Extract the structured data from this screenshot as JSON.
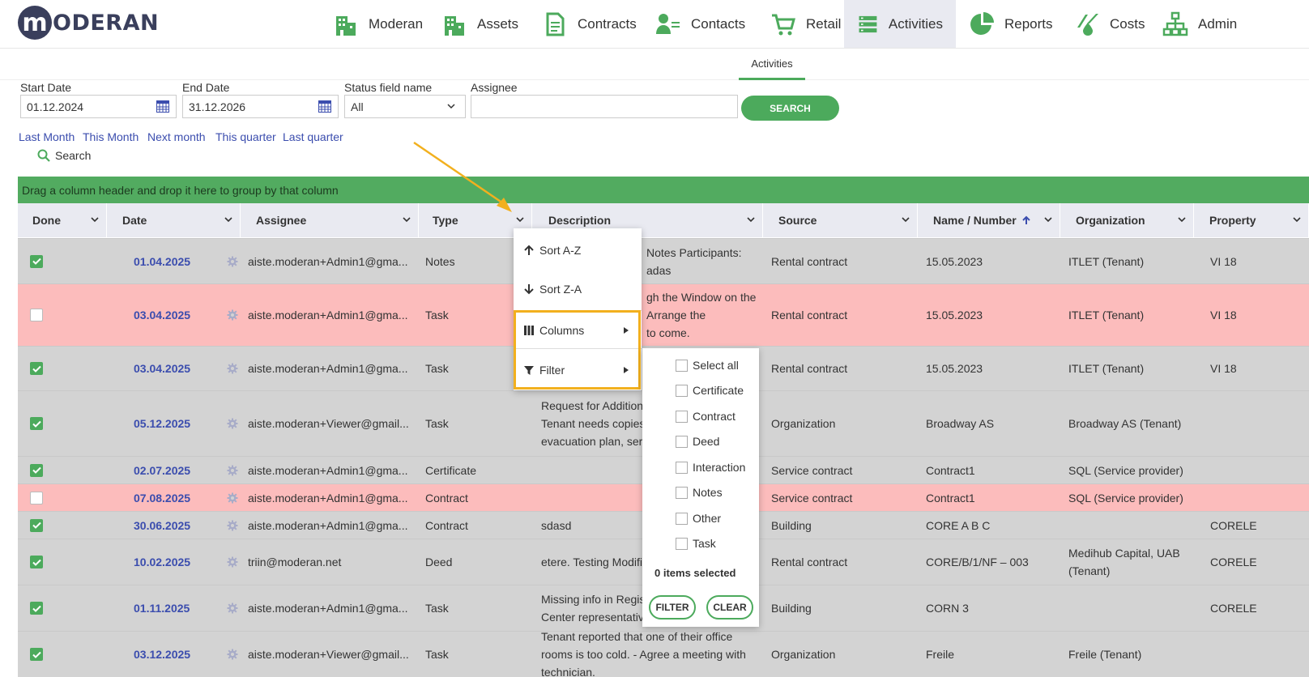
{
  "app": {
    "logo_initial": "m",
    "logo_text": "ODERAN"
  },
  "nav": [
    {
      "label": "Moderan",
      "icon": "building-icon"
    },
    {
      "label": "Assets",
      "icon": "building-icon"
    },
    {
      "label": "Contracts",
      "icon": "document-icon"
    },
    {
      "label": "Contacts",
      "icon": "person-card-icon"
    },
    {
      "label": "Retail",
      "icon": "cart-icon"
    },
    {
      "label": "Activities",
      "icon": "list-icon",
      "active": true
    },
    {
      "label": "Reports",
      "icon": "pie-chart-icon"
    },
    {
      "label": "Costs",
      "icon": "costs-icon"
    },
    {
      "label": "Admin",
      "icon": "org-chart-icon"
    }
  ],
  "subnav": {
    "tab": "Activities"
  },
  "filters": {
    "start_label": "Start Date",
    "start_value": "01.12.2024",
    "end_label": "End Date",
    "end_value": "31.12.2026",
    "status_label": "Status field name",
    "status_value": "All",
    "assignee_label": "Assignee",
    "assignee_value": "",
    "search_button": "SEARCH"
  },
  "quick_links": [
    "Last Month",
    "This Month",
    "Next month",
    "This quarter",
    "Last quarter"
  ],
  "grid_search": "Search",
  "group_bar": "Drag a column header and drop it here to group by that column",
  "columns": [
    "Done",
    "Date",
    "Assignee",
    "Type",
    "Description",
    "Source",
    "Name / Number",
    "Organization",
    "Property"
  ],
  "rows": [
    {
      "done": true,
      "date": "01.04.2025",
      "assignee": "aiste.moderan+Admin1@gma...",
      "type": "Notes",
      "description": [
        "Notes Participants:",
        "adas"
      ],
      "source": "Rental contract",
      "name": "15.05.2023",
      "org": [
        "ITLET (Tenant)"
      ],
      "property": "VI 18"
    },
    {
      "done": false,
      "date": "03.04.2025",
      "assignee": "aiste.moderan+Admin1@gma...",
      "type": "Task",
      "description": [
        "gh the Window on the",
        "Arrange the",
        "to come."
      ],
      "source": "Rental contract",
      "name": "15.05.2023",
      "org": [
        "ITLET (Tenant)"
      ],
      "property": "VI 18"
    },
    {
      "done": true,
      "date": "03.04.2025",
      "assignee": "aiste.moderan+Admin1@gma...",
      "type": "Task",
      "description": [],
      "source": "Rental contract",
      "name": "15.05.2023",
      "org": [
        "ITLET (Tenant)"
      ],
      "property": "VI 18"
    },
    {
      "done": true,
      "date": "05.12.2025",
      "assignee": "aiste.moderan+Viewer@gmail...",
      "type": "Task",
      "description": [
        "Request for Addition",
        "Tenant needs copies",
        "evacuation plan, serv"
      ],
      "source": "Organization",
      "name": "Broadway AS",
      "org": [
        "Broadway AS (Tenant)"
      ],
      "property": ""
    },
    {
      "done": true,
      "date": "02.07.2025",
      "assignee": "aiste.moderan+Admin1@gma...",
      "type": "Certificate",
      "description": [],
      "source": "Service contract",
      "name": "Contract1",
      "org": [
        "SQL (Service provider)"
      ],
      "property": ""
    },
    {
      "done": false,
      "date": "07.08.2025",
      "assignee": "aiste.moderan+Admin1@gma...",
      "type": "Contract",
      "description": [],
      "source": "Service contract",
      "name": "Contract1",
      "org": [
        "SQL (Service provider)"
      ],
      "property": ""
    },
    {
      "done": true,
      "date": "30.06.2025",
      "assignee": "aiste.moderan+Admin1@gma...",
      "type": "Contract",
      "description": [
        "sdasd"
      ],
      "source": "Building",
      "name": "CORE A B C",
      "org": [],
      "property": "CORELE"
    },
    {
      "done": true,
      "date": "10.02.2025",
      "assignee": "triin@moderan.net",
      "type": "Deed",
      "description": [
        "etere. Testing Modifi"
      ],
      "source": "Rental contract",
      "name": "CORE/B/1/NF – 003",
      "org": [
        "Medihub Capital, UAB",
        "(Tenant)"
      ],
      "property": "CORELE"
    },
    {
      "done": true,
      "date": "01.11.2025",
      "assignee": "aiste.moderan+Admin1@gma...",
      "type": "Task",
      "description": [
        "Missing info in Regis",
        "Center representativ"
      ],
      "source": "Building",
      "name": "CORN 3",
      "org": [],
      "property": "CORELE"
    },
    {
      "done": true,
      "date": "03.12.2025",
      "assignee": "aiste.moderan+Viewer@gmail...",
      "type": "Task",
      "description": [
        "Tenant reported that one of their office",
        "rooms is too cold. - Agree a meeting with",
        "technician."
      ],
      "source": "Organization",
      "name": "Freile",
      "org": [
        "Freile (Tenant)"
      ],
      "property": ""
    }
  ],
  "context_menu": {
    "sort_az": "Sort A-Z",
    "sort_za": "Sort Z-A",
    "columns": "Columns",
    "filter": "Filter"
  },
  "filter_panel": {
    "options": [
      "Select all",
      "Certificate",
      "Contract",
      "Deed",
      "Interaction",
      "Notes",
      "Other",
      "Task"
    ],
    "count": "0 items selected",
    "filter_button": "FILTER",
    "clear_button": "CLEAR"
  },
  "colors": {
    "green": "#4caa5c",
    "blue_link": "#3b4dae",
    "row_done": "#d3d3d3",
    "row_open": "#fcbcbc",
    "highlight": "#f2b01e"
  }
}
